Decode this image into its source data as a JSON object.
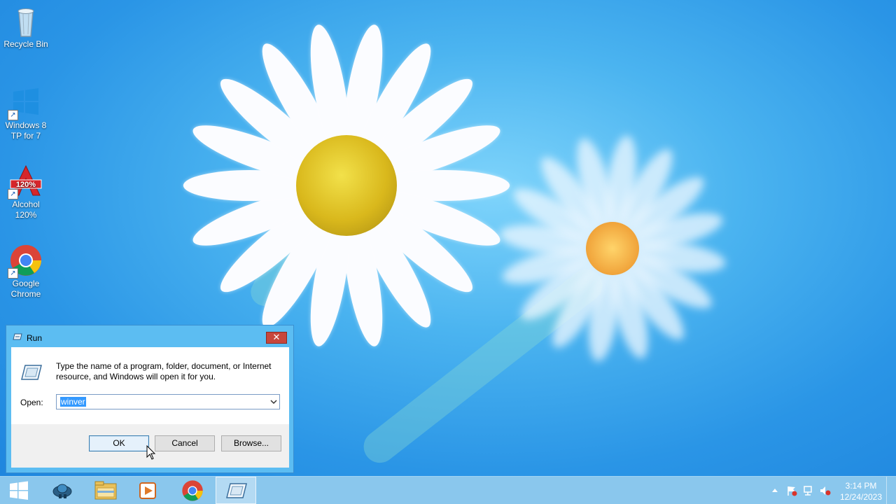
{
  "desktop": {
    "icons": [
      {
        "label": "Recycle Bin"
      },
      {
        "label": "Windows 8 TP for 7"
      },
      {
        "label": "Alcohol 120%"
      },
      {
        "label": "Google Chrome"
      }
    ]
  },
  "run_dialog": {
    "title": "Run",
    "close_symbol": "✕",
    "description": "Type the name of a program, folder, document, or Internet resource, and Windows will open it for you.",
    "open_label": "Open:",
    "open_value": "winver",
    "buttons": {
      "ok": "OK",
      "cancel": "Cancel",
      "browse": "Browse..."
    }
  },
  "taskbar": {
    "items": [
      "start-button",
      "vmware-icon",
      "file-explorer-icon",
      "media-player-icon",
      "chrome-icon",
      "run-icon"
    ],
    "active_item": "run-icon",
    "clock": {
      "time": "3:14 PM",
      "date": "12/24/2023"
    }
  },
  "colors": {
    "accent": "#5cbdf2",
    "close_button": "#c7463c",
    "selection": "#3399ff"
  }
}
